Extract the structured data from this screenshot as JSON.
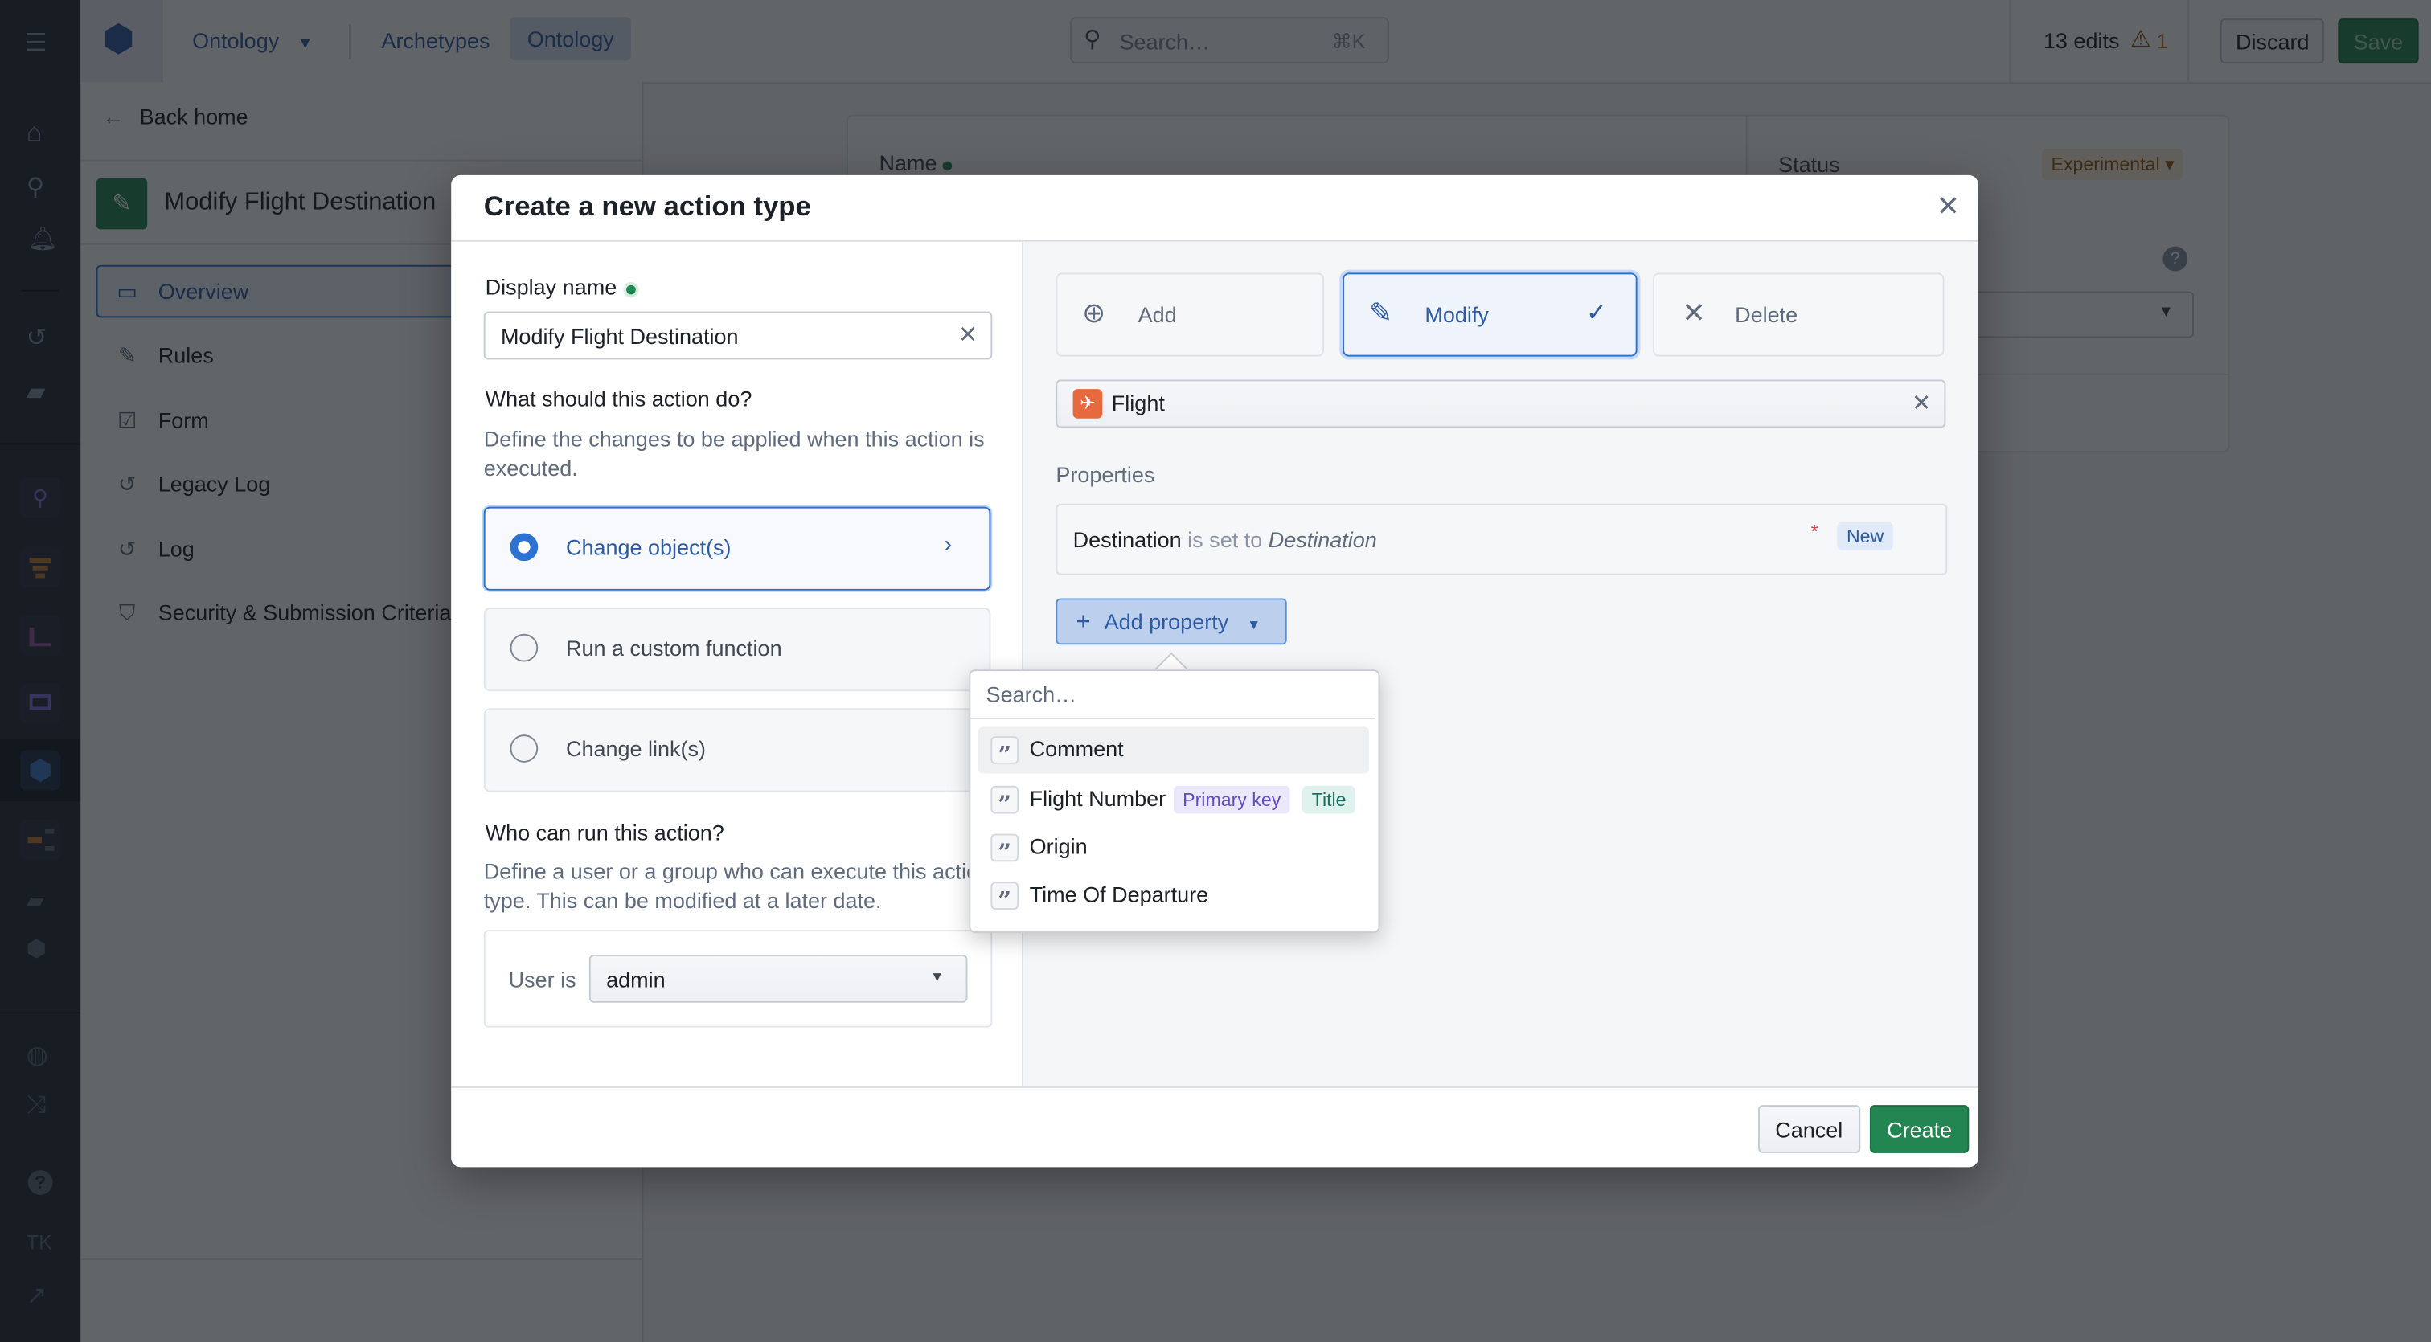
{
  "topbar": {
    "app_dropdown": "Ontology",
    "tabs": [
      {
        "label": "Archetypes"
      },
      {
        "label": "Ontology",
        "active": true
      }
    ],
    "search_placeholder": "Search…",
    "search_shortcut": "⌘K",
    "edits": "13 edits",
    "warnings": "1",
    "discard": "Discard",
    "save": "Save"
  },
  "left_panel": {
    "back": "Back home",
    "title": "Modify Flight Destination",
    "items": [
      {
        "label": "Overview",
        "icon": "desktop-icon",
        "active": true
      },
      {
        "label": "Rules",
        "icon": "pencil-icon"
      },
      {
        "label": "Form",
        "icon": "form-list-icon"
      },
      {
        "label": "Legacy Log",
        "icon": "history-icon"
      },
      {
        "label": "Log",
        "icon": "history-icon"
      },
      {
        "label": "Security & Submission Criteria",
        "icon": "shield-icon"
      }
    ]
  },
  "background": {
    "name_label": "Name",
    "status_label": "Status",
    "status_value": "Experimental"
  },
  "modal": {
    "title": "Create a new action type",
    "display_name_label": "Display name",
    "display_name_value": "Modify Flight Destination",
    "what_heading": "What should this action do?",
    "what_desc": "Define the changes to be applied when this action is executed.",
    "options": [
      {
        "label": "Change object(s)",
        "selected": true
      },
      {
        "label": "Run a custom function",
        "selected": false
      },
      {
        "label": "Change link(s)",
        "selected": false
      }
    ],
    "who_heading": "Who can run this action?",
    "who_desc": "Define a user or a group who can execute this action type. This can be modified at a later date.",
    "user_is_label": "User is",
    "user_value": "admin",
    "operations": [
      {
        "label": "Add",
        "icon": "plus-circle-icon"
      },
      {
        "label": "Modify",
        "icon": "pencil-icon",
        "selected": true
      },
      {
        "label": "Delete",
        "icon": "cross-icon"
      }
    ],
    "object_type": "Flight",
    "properties_label": "Properties",
    "property_rule": {
      "property": "Destination",
      "connector": "is set to",
      "value": "Destination",
      "required": "*",
      "badge": "New"
    },
    "add_property": "Add property",
    "cancel": "Cancel",
    "create": "Create"
  },
  "popover": {
    "search_placeholder": "Search…",
    "items": [
      {
        "label": "Comment",
        "tags": []
      },
      {
        "label": "Flight Number",
        "tags": [
          "Primary key",
          "Title"
        ]
      },
      {
        "label": "Origin",
        "tags": []
      },
      {
        "label": "Time Of Departure",
        "tags": []
      }
    ]
  },
  "colors": {
    "primary": "#2d72d2",
    "success": "#238551",
    "flight_icon": "#e76a3f"
  }
}
